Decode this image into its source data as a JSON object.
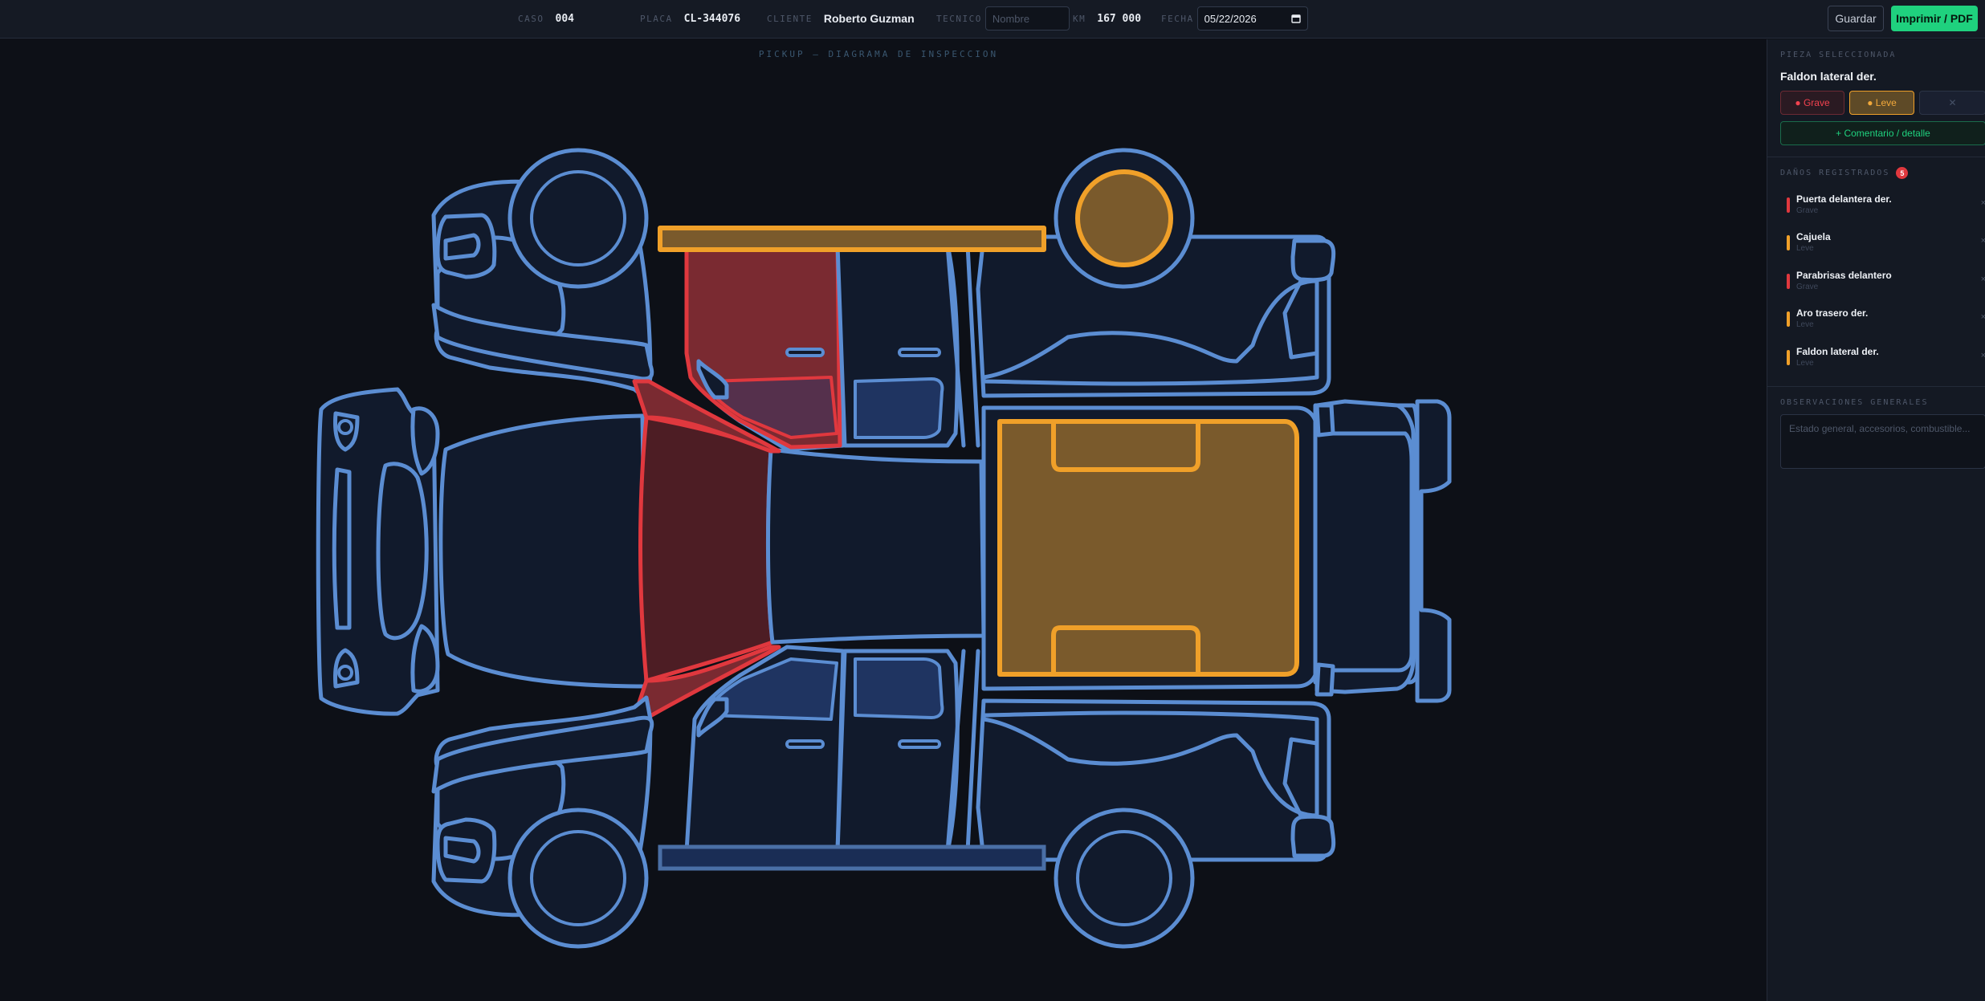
{
  "header": {
    "case_label": "CASO",
    "case_value": "004",
    "plate_label": "PLACA",
    "plate_value": "CL-344076",
    "client_label": "CLIENTE",
    "client_value": "Roberto Guzman",
    "tech_label": "TECNICO",
    "tech_placeholder": "Nombre",
    "km_label": "KM",
    "km_value": "167 000",
    "date_label": "FECHA",
    "date_value": "05/22/2026",
    "save_label": "Guardar",
    "print_label": "Imprimir / PDF"
  },
  "canvas": {
    "title": "PICKUP — DIAGRAMA DE INSPECCION"
  },
  "sidebar": {
    "selected_heading": "PIEZA SELECCIONADA",
    "selected_part": "Faldon lateral der.",
    "grave_label": "● Grave",
    "leve_label": "● Leve",
    "clear_label": "✕",
    "comment_label": "+ Comentario / detalle",
    "damages_heading": "DAÑOS REGISTRADOS",
    "damages_count": "5",
    "damages": [
      {
        "name": "Puerta delantera der.",
        "severity": "Grave",
        "color": "#e0383e"
      },
      {
        "name": "Cajuela",
        "severity": "Leve",
        "color": "#f0a029"
      },
      {
        "name": "Parabrisas delantero",
        "severity": "Grave",
        "color": "#e0383e"
      },
      {
        "name": "Aro trasero der.",
        "severity": "Leve",
        "color": "#f0a029"
      },
      {
        "name": "Faldon lateral der.",
        "severity": "Leve",
        "color": "#f0a029"
      }
    ],
    "remove_glyph": "×",
    "obs_heading": "OBSERVACIONES GENERALES",
    "obs_placeholder": "Estado general, accesorios, combustible..."
  },
  "colors": {
    "grave": "#e0383e",
    "leve": "#f0a029",
    "accent": "#1fd17e",
    "outline": "#5b8dd2"
  }
}
